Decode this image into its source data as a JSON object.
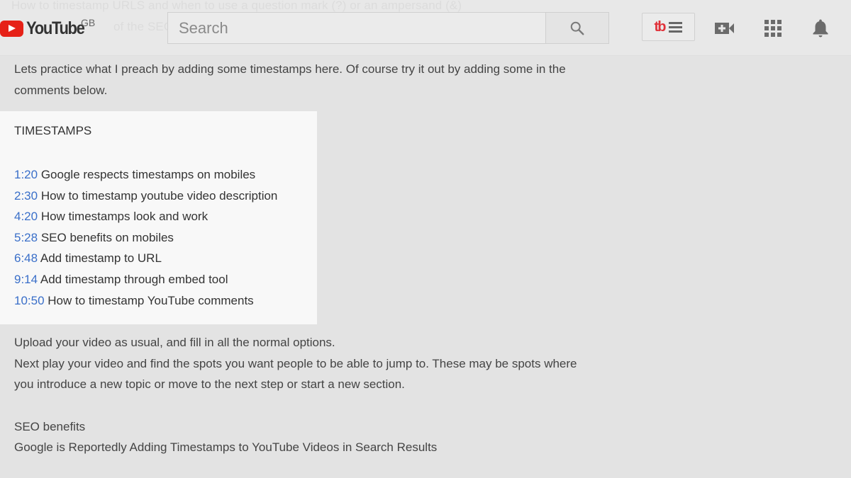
{
  "background_overlay": {
    "line1": "How to timestamp URLS and when to use a question mark (?) or an ampersand (&)",
    "line2": "of the SEO"
  },
  "header": {
    "logo_text": "YouTube",
    "region": "GB",
    "search_placeholder": "Search",
    "icons": {
      "search": "search-icon",
      "tubebuddy": "tubebuddy-icon",
      "upload": "video-camera-plus-icon",
      "apps": "apps-grid-icon",
      "notifications": "bell-icon"
    },
    "tubebuddy_label": "tb"
  },
  "description": {
    "intro": [
      "Lets practice what I preach by adding some timestamps here. Of course try it out by adding some in the",
      "comments below."
    ],
    "timestamps_heading": "TIMESTAMPS",
    "timestamps": [
      {
        "time": "1:20",
        "label": "Google respects timestamps on mobiles"
      },
      {
        "time": "2:30",
        "label": "How to timestamp youtube video description"
      },
      {
        "time": "4:20",
        "label": "How timestamps look and work"
      },
      {
        "time": "5:28",
        "label": "SEO benefits on mobiles"
      },
      {
        "time": "6:48",
        "label": "Add timestamp to URL"
      },
      {
        "time": "9:14",
        "label": "Add timestamp through embed tool"
      },
      {
        "time": "10:50",
        "label": "How to timestamp YouTube comments"
      }
    ],
    "body": [
      "Upload your video as usual, and fill in all the normal options.",
      "Next play your video and find the spots you want people to be able to jump to. These may be spots where",
      "you introduce a new topic or move to the next step or start a new section."
    ],
    "seo_heading": "SEO benefits",
    "seo_link": "Google is Reportedly Adding Timestamps to YouTube Videos in Search Results"
  },
  "colors": {
    "timestamp_link": "#3a6fc9",
    "youtube_red": "#e62117",
    "tubebuddy_red": "#e0323a"
  }
}
